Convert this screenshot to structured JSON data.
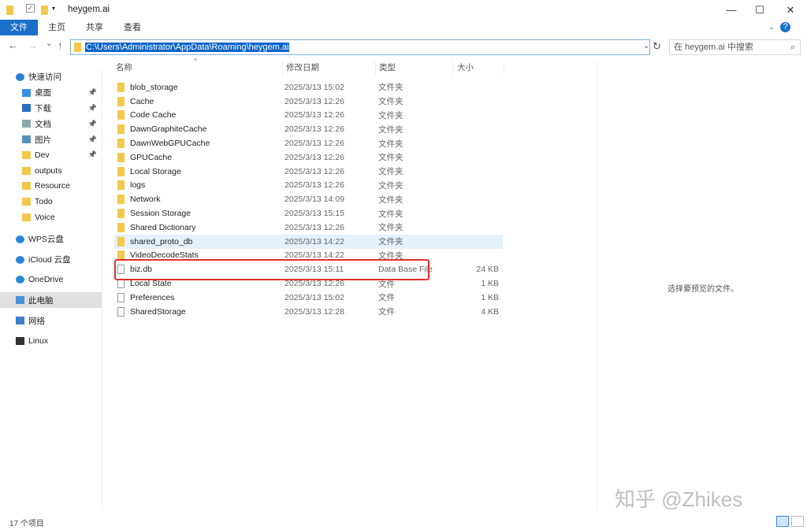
{
  "window": {
    "title": "heygem.ai",
    "minimize": "—",
    "maximize": "☐",
    "close": "✕"
  },
  "ribbon": {
    "tabs": [
      "文件",
      "主页",
      "共享",
      "查看"
    ],
    "help": "?"
  },
  "nav": {
    "back": "←",
    "forward": "→",
    "recent": "⌄",
    "up": "↑",
    "refresh": "↻",
    "dropdown": "⌄"
  },
  "address": {
    "path": "C:\\Users\\Administrator\\AppData\\Roaming\\heygem.ai"
  },
  "search": {
    "placeholder": "在 heygem.ai 中搜索",
    "icon": "⌕"
  },
  "sidebar": {
    "items": [
      {
        "label": "快速访问",
        "icon": "star-icon"
      },
      {
        "label": "桌面",
        "icon": "desktop-icon",
        "pinned": true
      },
      {
        "label": "下载",
        "icon": "download-icon",
        "pinned": true
      },
      {
        "label": "文档",
        "icon": "document-icon",
        "pinned": true
      },
      {
        "label": "图片",
        "icon": "picture-icon",
        "pinned": true
      },
      {
        "label": "Dev",
        "icon": "folder-icon",
        "pinned": true
      },
      {
        "label": "outputs",
        "icon": "folder-icon"
      },
      {
        "label": "Resource",
        "icon": "folder-icon"
      },
      {
        "label": "Todo",
        "icon": "folder-icon"
      },
      {
        "label": "Voice",
        "icon": "folder-icon"
      },
      {
        "label": "WPS云盘",
        "icon": "cloud-icon"
      },
      {
        "label": "iCloud 云盘",
        "icon": "cloud-icon"
      },
      {
        "label": "OneDrive",
        "icon": "cloud-icon"
      },
      {
        "label": "此电脑",
        "icon": "computer-icon"
      },
      {
        "label": "网络",
        "icon": "network-icon"
      },
      {
        "label": "Linux",
        "icon": "linux-icon"
      }
    ]
  },
  "columns": {
    "name": "名称",
    "date": "修改日期",
    "type": "类型",
    "size": "大小"
  },
  "files": [
    {
      "name": "blob_storage",
      "date": "2025/3/13 15:02",
      "type": "文件夹",
      "size": "",
      "folder": true
    },
    {
      "name": "Cache",
      "date": "2025/3/13 12:26",
      "type": "文件夹",
      "size": "",
      "folder": true
    },
    {
      "name": "Code Cache",
      "date": "2025/3/13 12:26",
      "type": "文件夹",
      "size": "",
      "folder": true
    },
    {
      "name": "DawnGraphiteCache",
      "date": "2025/3/13 12:26",
      "type": "文件夹",
      "size": "",
      "folder": true
    },
    {
      "name": "DawnWebGPUCache",
      "date": "2025/3/13 12:26",
      "type": "文件夹",
      "size": "",
      "folder": true
    },
    {
      "name": "GPUCache",
      "date": "2025/3/13 12:26",
      "type": "文件夹",
      "size": "",
      "folder": true
    },
    {
      "name": "Local Storage",
      "date": "2025/3/13 12:26",
      "type": "文件夹",
      "size": "",
      "folder": true
    },
    {
      "name": "logs",
      "date": "2025/3/13 12:26",
      "type": "文件夹",
      "size": "",
      "folder": true
    },
    {
      "name": "Network",
      "date": "2025/3/13 14:09",
      "type": "文件夹",
      "size": "",
      "folder": true
    },
    {
      "name": "Session Storage",
      "date": "2025/3/13 15:15",
      "type": "文件夹",
      "size": "",
      "folder": true
    },
    {
      "name": "Shared Dictionary",
      "date": "2025/3/13 12:26",
      "type": "文件夹",
      "size": "",
      "folder": true
    },
    {
      "name": "shared_proto_db",
      "date": "2025/3/13 14:22",
      "type": "文件夹",
      "size": "",
      "folder": true
    },
    {
      "name": "VideoDecodeStats",
      "date": "2025/3/13 14:22",
      "type": "文件夹",
      "size": "",
      "folder": true
    },
    {
      "name": "biz.db",
      "date": "2025/3/13 15:11",
      "type": "Data Base File",
      "size": "24 KB",
      "folder": false
    },
    {
      "name": "Local State",
      "date": "2025/3/13 12:26",
      "type": "文件",
      "size": "1 KB",
      "folder": false
    },
    {
      "name": "Preferences",
      "date": "2025/3/13 15:02",
      "type": "文件",
      "size": "1 KB",
      "folder": false
    },
    {
      "name": "SharedStorage",
      "date": "2025/3/13 12:28",
      "type": "文件",
      "size": "4 KB",
      "folder": false
    }
  ],
  "preview": {
    "message": "选择要预览的文件。"
  },
  "status": {
    "count": "17 个项目"
  },
  "watermark": "知乎 @Zhikes",
  "colors": {
    "accent": "#1a6fc9",
    "highlight": "#e5f1fb",
    "annotation": "#e0302f"
  }
}
